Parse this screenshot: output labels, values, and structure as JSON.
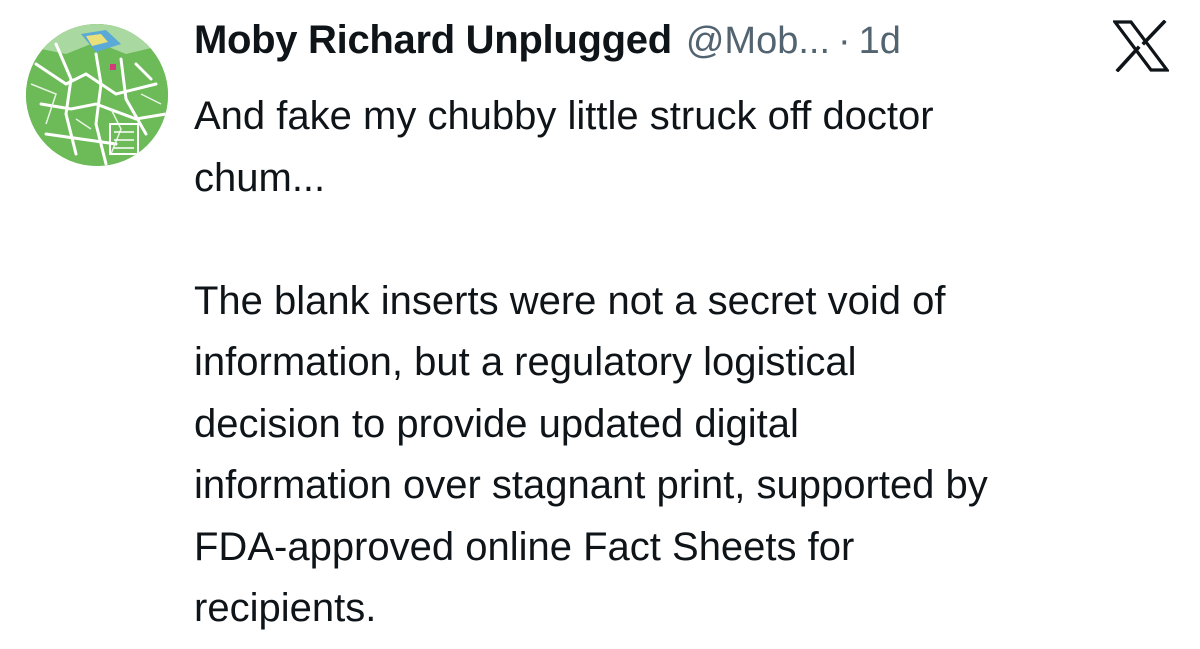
{
  "tweet": {
    "author_name": "Moby Richard Unplugged",
    "handle": "@Mob...",
    "separator": "·",
    "time": "1d",
    "platform_icon": "x-logo-icon",
    "avatar_icon": "map-avatar",
    "paragraph_1_lines": [
      "And fake my chubby little struck off doctor",
      "chum..."
    ],
    "paragraph_2_lines": [
      "The blank inserts were not a secret void of",
      "information, but a regulatory logistical",
      "decision to provide updated digital",
      "information over stagnant print, supported by",
      "FDA-approved online Fact Sheets for",
      "recipients."
    ]
  },
  "colors": {
    "text": "#0f1419",
    "secondary": "#536471",
    "avatar_green": "#6dbb5a"
  }
}
